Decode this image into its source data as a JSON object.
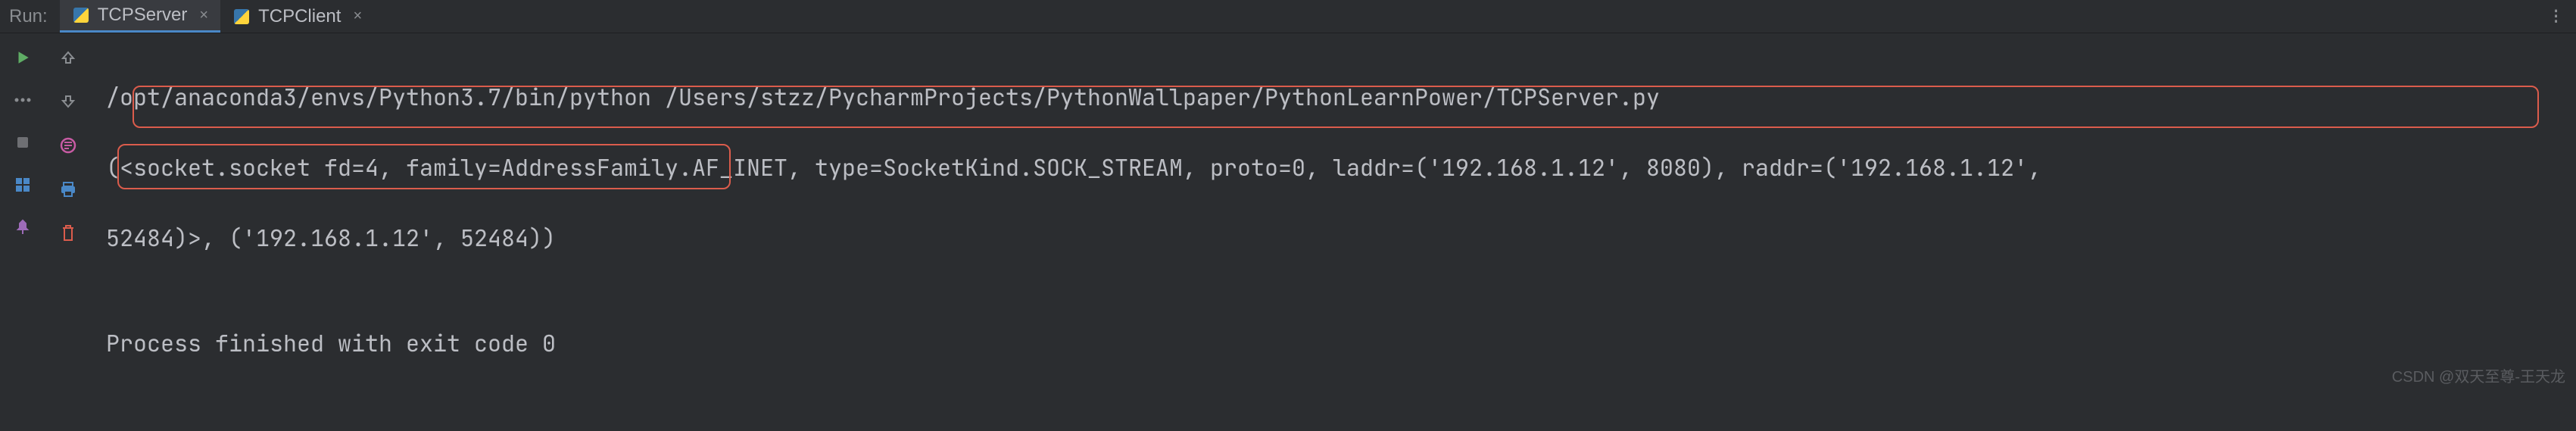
{
  "run_label": "Run:",
  "tabs": [
    {
      "label": "TCPServer",
      "active": true
    },
    {
      "label": "TCPClient",
      "active": false
    }
  ],
  "toolbar": {
    "play": "play-icon",
    "stop": "stop-icon",
    "layout": "layout-icon",
    "pin": "pin-icon"
  },
  "second_toolbar": {
    "up": "up-arrow-icon",
    "down": "down-arrow-icon",
    "wrap": "wrap-icon",
    "print": "print-icon",
    "trash": "trash-icon"
  },
  "console": {
    "command": "/opt/anaconda3/envs/Python3.7/bin/python /Users/stzz/PycharmProjects/PythonWallpaper/PythonLearnPower/TCPServer.py",
    "output_line1": "(<socket.socket fd=4, family=AddressFamily.AF_INET, type=SocketKind.SOCK_STREAM, proto=0, laddr=('192.168.1.12', 8080), raddr=('192.168.1.12',",
    "output_line2": "52484)>, ('192.168.1.12', 52484))",
    "exit": "Process finished with exit code 0"
  },
  "watermark": "CSDN @双天至尊-王天龙"
}
